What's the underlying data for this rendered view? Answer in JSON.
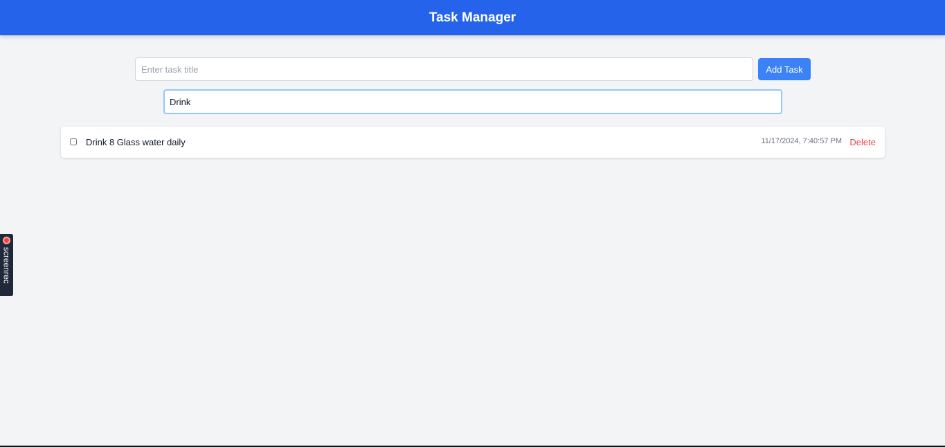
{
  "header": {
    "title": "Task Manager"
  },
  "task_form": {
    "title_placeholder": "Enter task title",
    "title_value": "",
    "add_label": "Add Task"
  },
  "search": {
    "value": "Drink"
  },
  "tasks": [
    {
      "title": "Drink 8 Glass water daily",
      "completed": false,
      "created_at": "11/17/2024, 7:40:57 PM",
      "delete_label": "Delete"
    }
  ],
  "recorder": {
    "label": "screenrec"
  },
  "colors": {
    "header_bg": "#2563eb",
    "button_bg": "#3b82f6",
    "delete": "#ef4444",
    "page_bg": "#f3f4f6"
  },
  "icons": {
    "recorder": "record-dot-icon"
  }
}
